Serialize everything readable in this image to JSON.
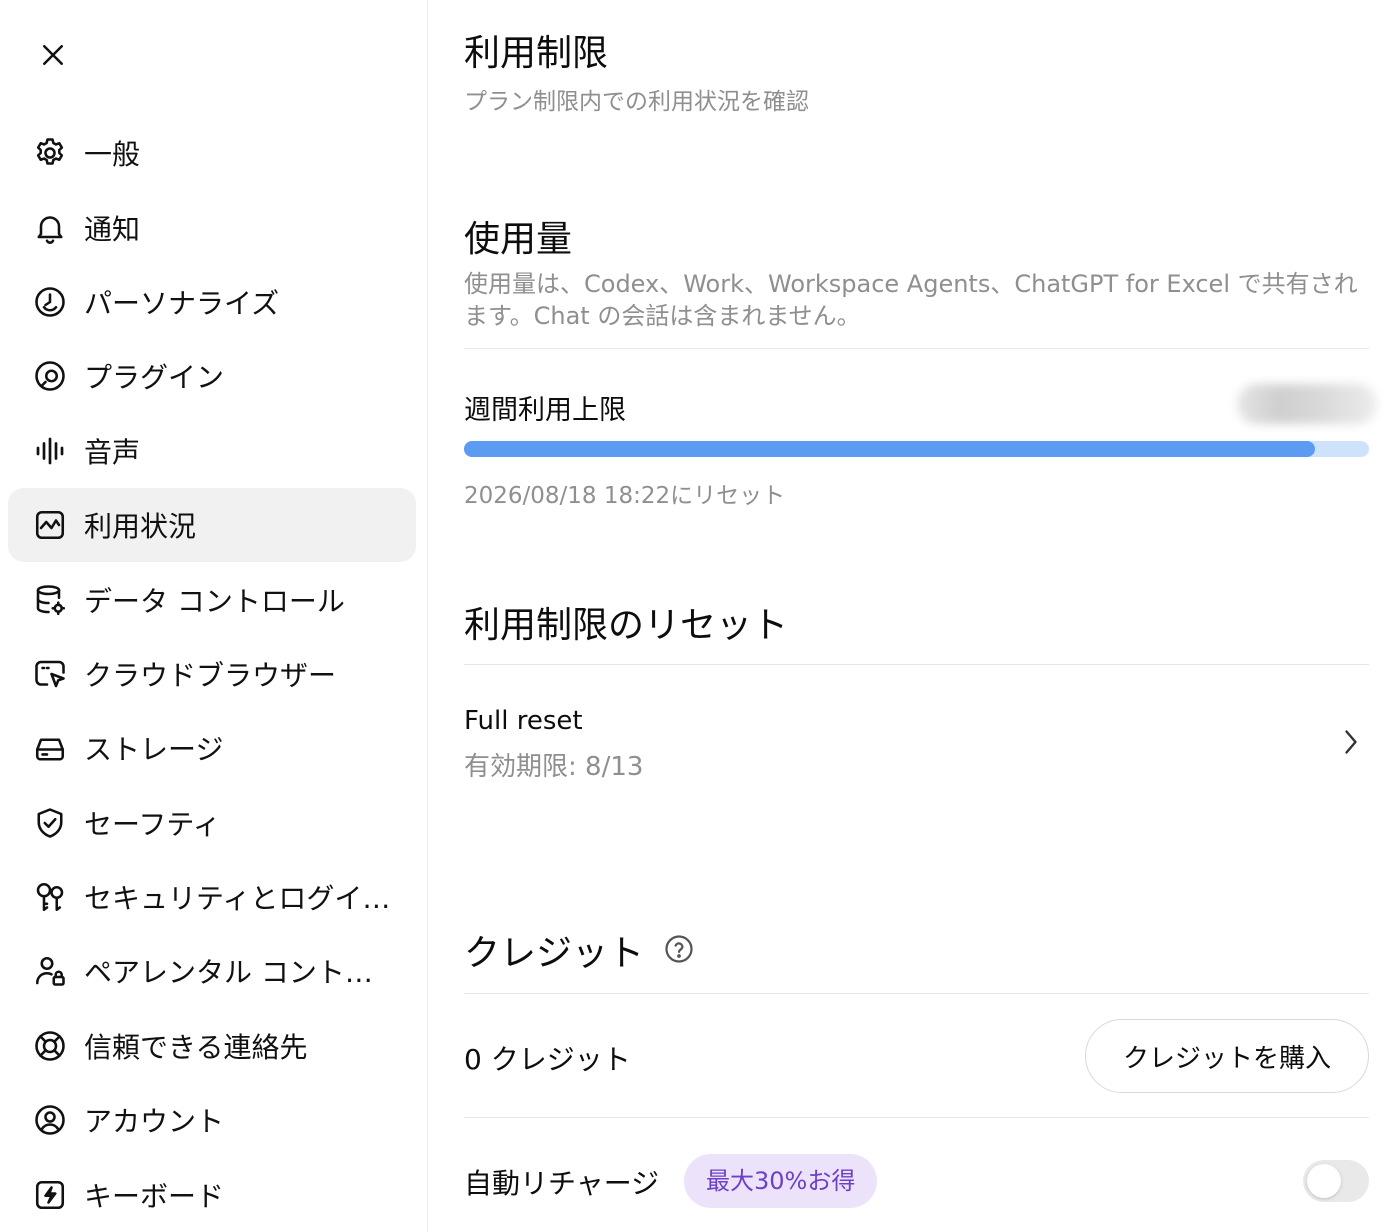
{
  "sidebar": {
    "close_icon": "close-icon",
    "items": [
      {
        "label": "一般",
        "icon": "gear-icon"
      },
      {
        "label": "通知",
        "icon": "bell-icon"
      },
      {
        "label": "パーソナライズ",
        "icon": "personalize-icon"
      },
      {
        "label": "プラグイン",
        "icon": "plugin-icon"
      },
      {
        "label": "音声",
        "icon": "audio-wave-icon"
      },
      {
        "label": "利用状況",
        "icon": "usage-chart-icon",
        "active": true
      },
      {
        "label": "データ コントロール",
        "icon": "database-gear-icon"
      },
      {
        "label": "クラウドブラウザー",
        "icon": "cloud-browser-icon"
      },
      {
        "label": "ストレージ",
        "icon": "storage-drive-icon"
      },
      {
        "label": "セーフティ",
        "icon": "shield-check-icon"
      },
      {
        "label": "セキュリティとログイ…",
        "icon": "keys-icon"
      },
      {
        "label": "ペアレンタル コント…",
        "icon": "parental-user-lock-icon"
      },
      {
        "label": "信頼できる連絡先",
        "icon": "lifebuoy-icon"
      },
      {
        "label": "アカウント",
        "icon": "account-circle-icon"
      },
      {
        "label": "キーボード",
        "icon": "keyboard-bolt-icon"
      }
    ]
  },
  "main": {
    "title": "利用制限",
    "subtitle": "プラン制限内での利用状況を確認",
    "usage": {
      "heading": "使用量",
      "description": "使用量は、Codex、Work、Workspace Agents、ChatGPT for Excel で共有されます。Chat の会話は含まれません。",
      "weekly_label": "週間利用上限",
      "progress_fraction": 0.94,
      "progress_color": "#5b9cf2",
      "track_color": "#cfe2fb",
      "reset_text": "2026/08/18 18:22にリセット"
    },
    "reset": {
      "heading": "利用制限のリセット",
      "item_title": "Full reset",
      "item_expiry": "有効期限: 8/13"
    },
    "credits": {
      "heading": "クレジット",
      "amount_label": "0 クレジット",
      "buy_button": "クレジットを購入",
      "auto_recharge_label": "自動リチャージ",
      "badge": "最大30%お得",
      "badge_color": "#6d40c8",
      "auto_recharge_on": false
    }
  }
}
